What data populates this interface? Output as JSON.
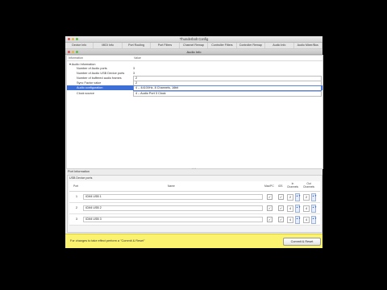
{
  "window": {
    "title": "Thunderbolt Config",
    "tabs": [
      "Device Info",
      "MIDI Info",
      "Port Routing",
      "Port Filters",
      "Channel Remap",
      "Controller Filters",
      "Controller Remap",
      "Audio Info",
      "Audio Mixer/Bus"
    ],
    "sub_title": "Audio Info"
  },
  "info_table": {
    "header_information": "Information",
    "header_value": "Value",
    "rows": [
      {
        "label": "▾ Audio Information",
        "value": ""
      },
      {
        "label": "Number of Audio ports",
        "value": "3"
      },
      {
        "label": "Number of Audio USB Device ports",
        "value": "3"
      },
      {
        "label": "Number of buffered audio frames",
        "value": "2"
      },
      {
        "label": "Sync Factor value",
        "value": "2"
      },
      {
        "label": "Audio configuration",
        "value": "4 – 44100Hz, 8 Channels, 16bit"
      },
      {
        "label": "Clock source",
        "value": "4 – Audio Port 3 Clock"
      }
    ]
  },
  "port_info": {
    "title": "Port Information",
    "subtitle": "USB Device ports",
    "headers": {
      "port": "Port",
      "name": "Name",
      "mac_pc": "Mac/PC",
      "ios": "iOS",
      "in_channels": "In Channels",
      "out_channels": "Out Channels"
    },
    "rows": [
      {
        "num": "1",
        "name": "iCM4 USB 1",
        "in": "2",
        "out": "2"
      },
      {
        "num": "2",
        "name": "iCM4 USB 2",
        "in": "4",
        "out": "4"
      },
      {
        "num": "3",
        "name": "iCM4 USB 3",
        "in": "4",
        "out": "4"
      }
    ]
  },
  "footer": {
    "message": "For changes to take effect perform a \"Commit & Reset\"",
    "commit_button": "Commit & Reset"
  }
}
